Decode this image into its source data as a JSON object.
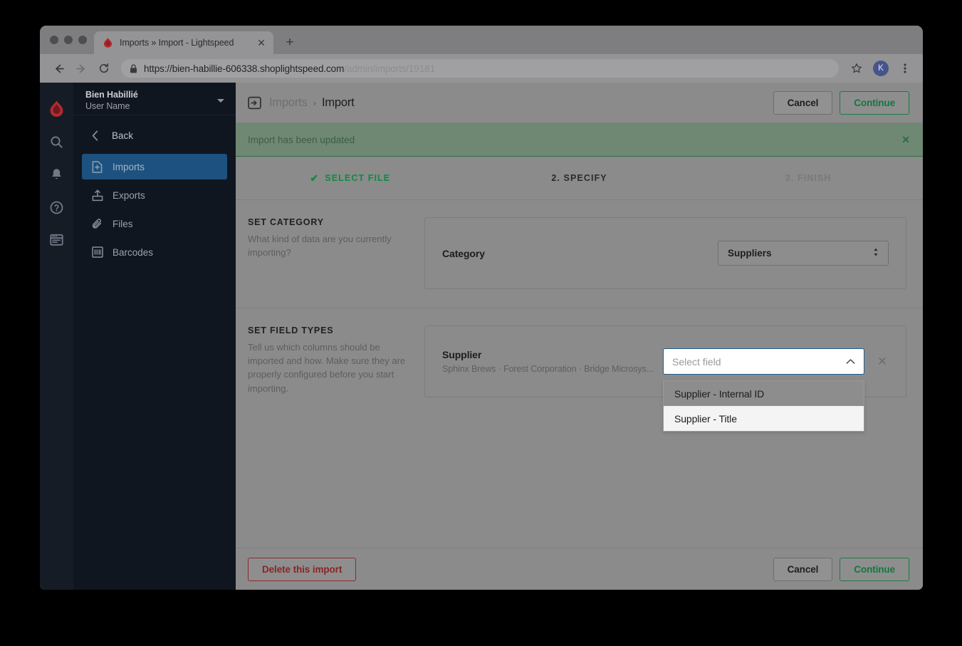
{
  "browser": {
    "tab": {
      "title": "Imports » Import - Lightspeed",
      "favicon": "lightspeed-flame-icon",
      "close_label": "✕",
      "new_tab_label": "+"
    },
    "toolbar": {
      "back_label": "←",
      "forward_label": "→",
      "reload_label": "⟳",
      "lock_icon": "lock-icon",
      "url_secure": "https://bien-habillie-606338.shoplightspeed.com",
      "url_path": "/admin/imports/19181",
      "bookmark_icon": "star-icon",
      "profile_initial": "K",
      "menu_icon": "kebab-menu-icon"
    }
  },
  "rail": {
    "logo": "lightspeed-flame-logo",
    "icons": [
      {
        "name": "search-icon",
        "glyph": "⌕"
      },
      {
        "name": "bell-icon",
        "glyph": "🔔"
      },
      {
        "name": "help-icon",
        "glyph": "?"
      },
      {
        "name": "browser-icon",
        "glyph": "▤"
      }
    ]
  },
  "sidebar": {
    "account": {
      "shop_name": "Bien Habillié",
      "user_name": "User Name",
      "chevron": "chevron-down-icon"
    },
    "back_label": "Back",
    "items": [
      {
        "label": "Imports",
        "icon": "import-file-icon",
        "active": true
      },
      {
        "label": "Exports",
        "icon": "export-upload-icon",
        "active": false
      },
      {
        "label": "Files",
        "icon": "paperclip-icon",
        "active": false
      },
      {
        "label": "Barcodes",
        "icon": "barcode-icon",
        "active": false
      }
    ]
  },
  "header": {
    "breadcrumb_icon": "import-icon",
    "breadcrumb_parent": "Imports",
    "breadcrumb_separator": "›",
    "breadcrumb_current": "Import",
    "cancel_label": "Cancel",
    "continue_label": "Continue"
  },
  "alert": {
    "message": "Import has been updated",
    "close_label": "✕"
  },
  "wizard": {
    "steps": [
      {
        "label": "SELECT FILE",
        "state": "done",
        "check": "✔"
      },
      {
        "label": "2. SPECIFY",
        "state": "current",
        "check": ""
      },
      {
        "label": "3. FINISH",
        "state": "todo",
        "check": ""
      }
    ]
  },
  "set_category": {
    "title": "SET CATEGORY",
    "description": "What kind of data are you currently importing?",
    "row_label": "Category",
    "select_value": "Suppliers",
    "select_arrows": "⬍"
  },
  "set_field_types": {
    "title": "SET FIELD TYPES",
    "description": "Tell us which columns should be imported and how. Make sure they are properly configured before you start importing.",
    "field_name": "Supplier",
    "field_sample": "Sphinx Brews · Forest Corporation · Bridge Microsys...",
    "combo_placeholder": "Select field",
    "combo_chevron": "chevron-up-icon",
    "remove_label": "✕",
    "options": [
      {
        "label": "Supplier - Internal ID",
        "hovered": false
      },
      {
        "label": "Supplier - Title",
        "hovered": true
      }
    ]
  },
  "footer": {
    "delete_label": "Delete this import",
    "cancel_label": "Cancel",
    "continue_label": "Continue"
  },
  "colors": {
    "sidebar_bg": "#10161f",
    "rail_bg": "#161c26",
    "active_nav": "#1d5280",
    "alert_bg": "#6f8873",
    "success_green": "#0f8a42",
    "danger_red": "#8a2525",
    "focus_blue": "#1c5f92"
  }
}
